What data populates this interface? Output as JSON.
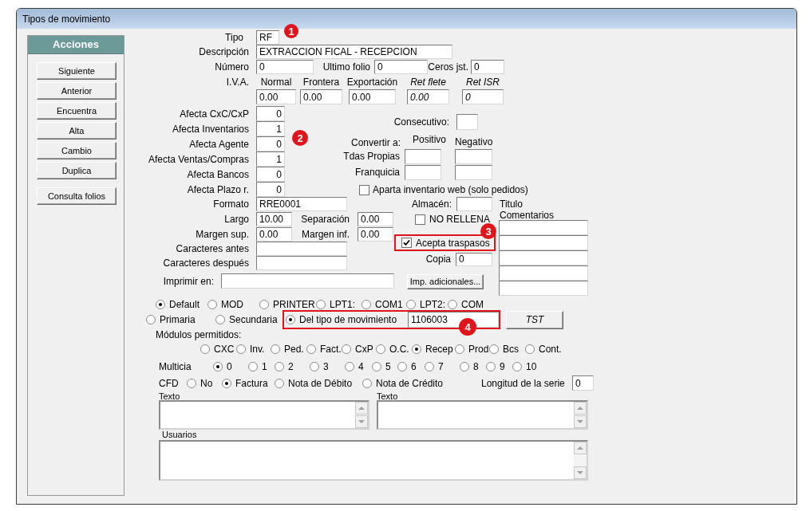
{
  "window": {
    "title": "Tipos de movimiento"
  },
  "actions_panel": {
    "title": "Acciones",
    "buttons": [
      "Siguiente",
      "Anterior",
      "Encuentra",
      "Alta",
      "Cambio",
      "Duplica",
      "Consulta folios"
    ]
  },
  "header_fields": {
    "tipo": {
      "label": "Tipo",
      "value": "RF",
      "callout": "1"
    },
    "descripcion": {
      "label": "Descripción",
      "value": "EXTRACCION FICAL - RECEPCION"
    },
    "numero": {
      "label": "Número",
      "value": "0"
    },
    "ultimo_folio": {
      "label": "Ultimo folio",
      "value": "0"
    },
    "ceros_jst": {
      "label": "Ceros jst.",
      "value": "0"
    }
  },
  "iva": {
    "label": "I.V.A.",
    "columns": [
      {
        "label": "Normal",
        "value": "0.00",
        "italic": false
      },
      {
        "label": "Frontera",
        "value": "0.00",
        "italic": false
      },
      {
        "label": "Exportación",
        "value": "0.00",
        "italic": false
      },
      {
        "label": "Ret flete",
        "value": "0.00",
        "italic": true
      },
      {
        "label": "Ret ISR",
        "value": "0",
        "italic": true
      }
    ]
  },
  "afecta": {
    "callout": "2",
    "rows": [
      {
        "label": "Afecta CxC/CxP",
        "value": "0"
      },
      {
        "label": "Afecta Inventarios",
        "value": "1"
      },
      {
        "label": "Afecta Agente",
        "value": "0"
      },
      {
        "label": "Afecta Ventas/Compras",
        "value": "1"
      },
      {
        "label": "Afecta Bancos",
        "value": "0"
      },
      {
        "label": "Afecta Plazo r.",
        "value": "0"
      }
    ]
  },
  "consecutivo": {
    "label": "Consecutivo:"
  },
  "convertir": {
    "label": "Convertir a:",
    "columns": [
      "Positivo",
      "Negativo"
    ],
    "rows": [
      {
        "label": "Tdas Propias"
      },
      {
        "label": "Franquicia"
      }
    ]
  },
  "aparta_inventario_web": {
    "label": "Aparta inventario web (solo pedidos)",
    "checked": false
  },
  "formato": {
    "label": "Formato",
    "value": "RRE0001"
  },
  "almacen": {
    "label": "Almacén:"
  },
  "comentarios": {
    "title": "Titulo",
    "label": "Comentarios"
  },
  "largo": {
    "label": "Largo",
    "value": "10.00"
  },
  "separacion": {
    "label": "Separación",
    "value": "0.00"
  },
  "no_rellena": {
    "label": "NO RELLENA",
    "checked": false
  },
  "margen_sup": {
    "label": "Margen sup.",
    "value": "0.00"
  },
  "margen_inf": {
    "label": "Margen inf.",
    "value": "0.00"
  },
  "acepta_traspasos": {
    "label": "Acepta traspasos",
    "checked": true,
    "highlighted": true,
    "callout": "3"
  },
  "caracteres_antes": {
    "label": "Caracteres antes"
  },
  "copia": {
    "label": "Copia",
    "value": "0"
  },
  "caracteres_despues": {
    "label": "Caracteres después"
  },
  "imprimir_en": {
    "label": "Imprimir en:"
  },
  "imp_adicionales_button": "Imp. adicionales...",
  "output": {
    "options": [
      {
        "label": "Default",
        "selected": true
      },
      {
        "label": "MOD",
        "selected": false
      },
      {
        "label": "PRINTER",
        "selected": false
      },
      {
        "label": "LPT1:",
        "selected": false
      },
      {
        "label": "COM1",
        "selected": false
      },
      {
        "label": "LPT2:",
        "selected": false
      },
      {
        "label": "COM",
        "selected": false
      }
    ]
  },
  "printer_source": {
    "options": [
      {
        "kind": "radio",
        "label": "Primaria",
        "selected": false
      },
      {
        "kind": "radio",
        "label": "Secundaria",
        "selected": false
      },
      {
        "kind": "radio_with_field",
        "label": "Del tipo de movimiento",
        "selected": true,
        "value": "1106003",
        "highlighted": true,
        "callout": "4"
      }
    ]
  },
  "tst_button": "TST",
  "modulos": {
    "label": "Módulos permitidos:",
    "options": [
      {
        "label": "CXC",
        "selected": false
      },
      {
        "label": "Inv.",
        "selected": false
      },
      {
        "label": "Ped.",
        "selected": false
      },
      {
        "label": "Fact.",
        "selected": false
      },
      {
        "label": "CxP",
        "selected": false
      },
      {
        "label": "O.C.",
        "selected": false
      },
      {
        "label": "Recep",
        "selected": true
      },
      {
        "label": "Prod",
        "selected": false
      },
      {
        "label": "Bcs",
        "selected": false
      },
      {
        "label": "Cont.",
        "selected": false
      }
    ]
  },
  "multicia": {
    "label": "Multicia",
    "options": [
      {
        "label": "0",
        "selected": true
      },
      {
        "label": "1",
        "selected": false
      },
      {
        "label": "2",
        "selected": false
      },
      {
        "label": "3",
        "selected": false
      },
      {
        "label": "4",
        "selected": false
      },
      {
        "label": "5",
        "selected": false
      },
      {
        "label": "6",
        "selected": false
      },
      {
        "label": "7",
        "selected": false
      },
      {
        "label": "8",
        "selected": false
      },
      {
        "label": "9",
        "selected": false
      },
      {
        "label": "10",
        "selected": false
      }
    ]
  },
  "cfd": {
    "label": "CFD",
    "options": [
      {
        "label": "No",
        "selected": false
      },
      {
        "label": "Factura",
        "selected": true
      },
      {
        "label": "Nota de Débito",
        "selected": false
      },
      {
        "label": "Nota de Crédito",
        "selected": false
      }
    ]
  },
  "longitud_serie": {
    "label": "Longitud de la serie",
    "value": "0"
  },
  "texto_boxes": [
    {
      "label": "Texto"
    },
    {
      "label": "Texto"
    }
  ],
  "usuarios": {
    "label": "Usuarios"
  }
}
